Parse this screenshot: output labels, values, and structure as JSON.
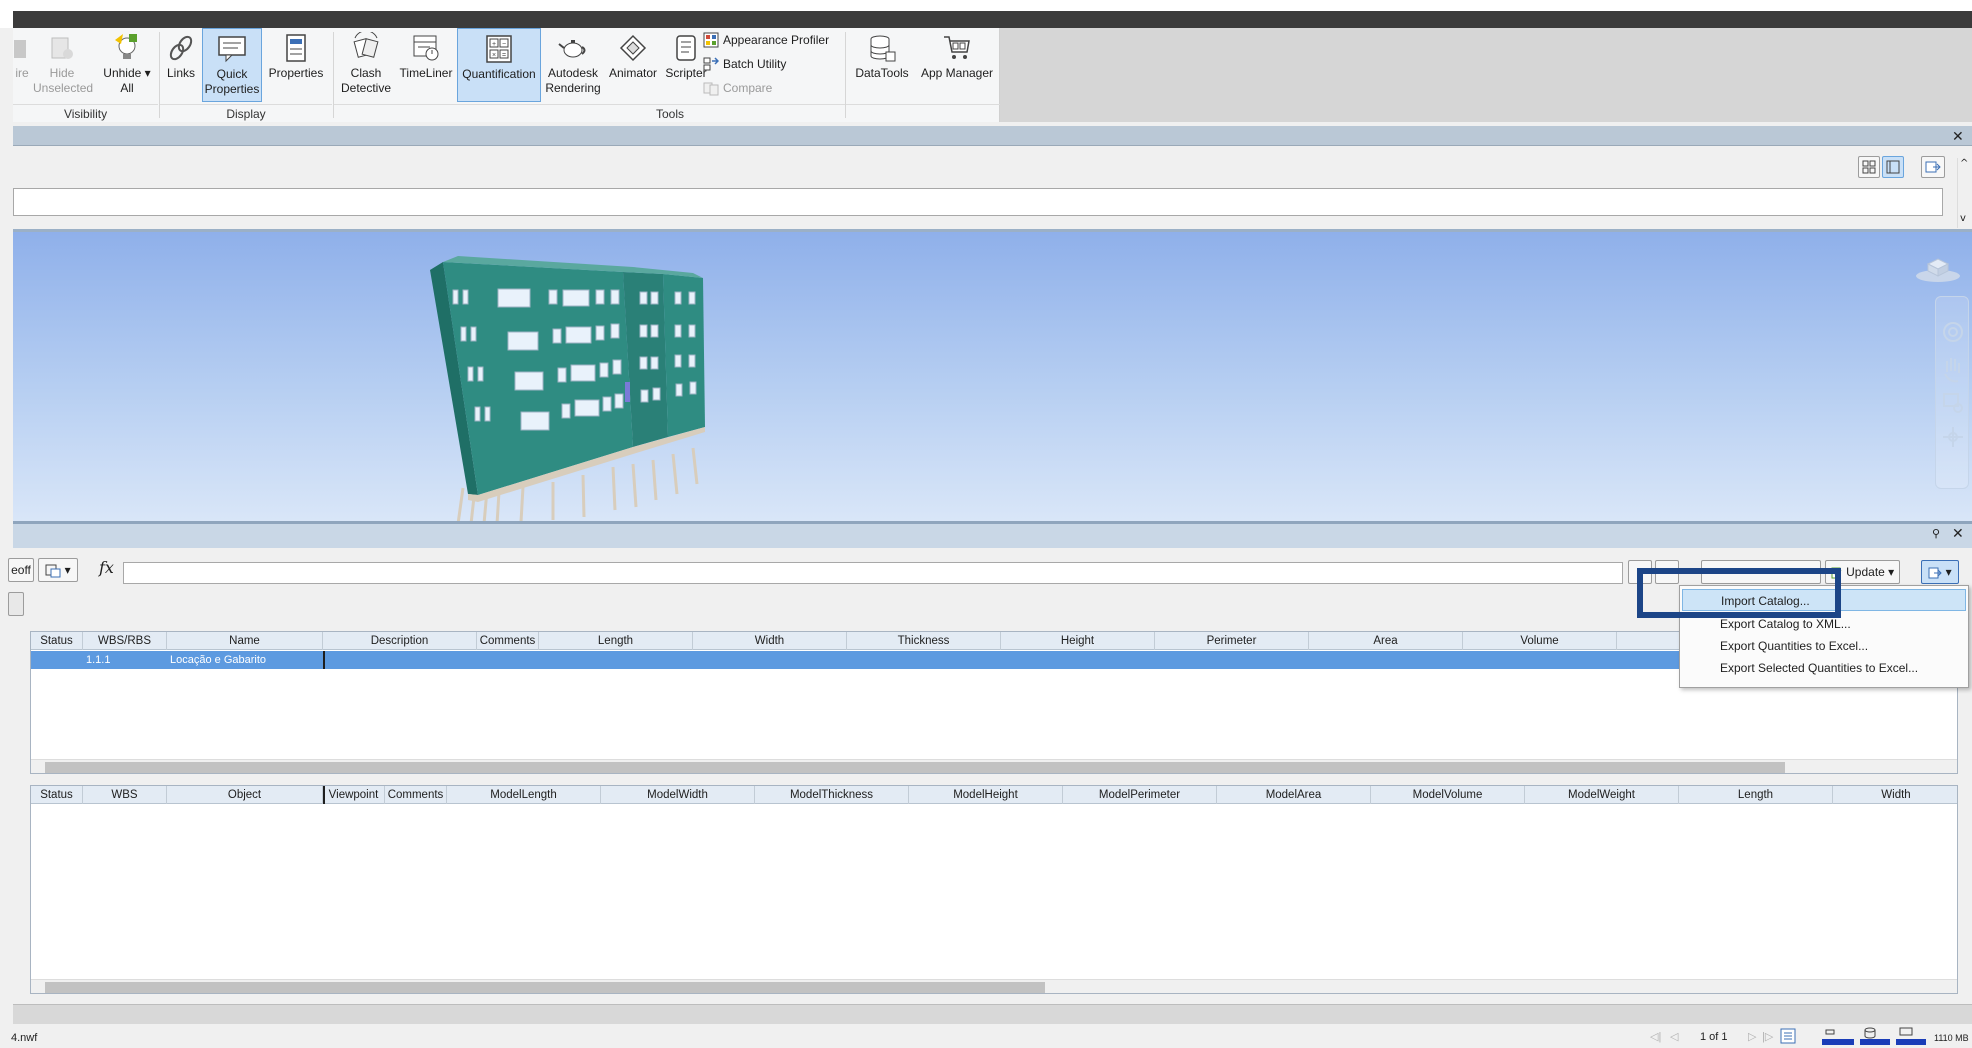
{
  "ribbon": {
    "visibility": {
      "group_label": "Visibility",
      "require_label": "ire",
      "hide_unselected": [
        "Hide",
        "Unselected"
      ],
      "unhide_all": [
        "Unhide",
        "All"
      ]
    },
    "display": {
      "group_label": "Display",
      "links": "Links",
      "quick_properties": [
        "Quick",
        "Properties"
      ],
      "properties": "Properties"
    },
    "tools": {
      "group_label": "Tools",
      "clash_detective": [
        "Clash",
        "Detective"
      ],
      "timeliner": "TimeLiner",
      "quantification": "Quantification",
      "autodesk_rendering": [
        "Autodesk",
        "Rendering"
      ],
      "animator": "Animator",
      "scripter": "Scripter",
      "appearance_profiler": "Appearance Profiler",
      "batch_utility": "Batch Utility",
      "compare": "Compare"
    },
    "datatools": "DataTools",
    "app_manager": "App Manager"
  },
  "quantification": {
    "takeoff_label": "eoff",
    "fx_label": "fx",
    "update_label": "Update",
    "items_grid": {
      "columns": [
        "Status",
        "WBS/RBS",
        "Name",
        "Description",
        "Comments",
        "Length",
        "Width",
        "Thickness",
        "Height",
        "Perimeter",
        "Area",
        "Volume"
      ],
      "rows": [
        {
          "status": "",
          "wbs": "1.1.1",
          "name": "Locação e Gabarito"
        }
      ]
    },
    "objects_grid": {
      "columns": [
        "Status",
        "WBS",
        "Object",
        "Viewpoint",
        "Comments",
        "ModelLength",
        "ModelWidth",
        "ModelThickness",
        "ModelHeight",
        "ModelPerimeter",
        "ModelArea",
        "ModelVolume",
        "ModelWeight",
        "Length",
        "Width"
      ]
    }
  },
  "menu": {
    "items": [
      "Import Catalog...",
      "Export Catalog to XML...",
      "Export Quantities to Excel...",
      "Export Selected Quantities to Excel..."
    ]
  },
  "statusbar": {
    "file": "4.nwf",
    "page": "1 of 1",
    "memory": "1110 MB"
  },
  "colors": {
    "accent": "#1c4587",
    "selection": "#5d9ae0",
    "building": "#2f8c82"
  }
}
